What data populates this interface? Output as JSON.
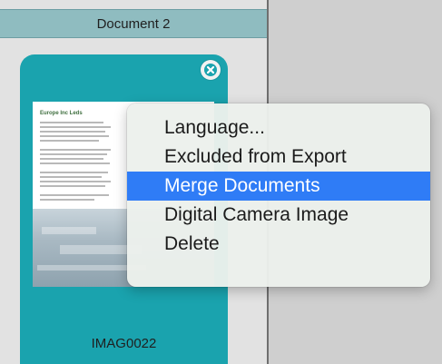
{
  "document_header": {
    "title": "Document 2"
  },
  "card": {
    "label": "IMAG0022",
    "thumbnail_title": "Europe Inc Leds",
    "close_icon": "close-circle-icon"
  },
  "context_menu": {
    "items": [
      {
        "label": "Language..."
      },
      {
        "label": "Excluded from Export"
      },
      {
        "label": "Merge Documents",
        "highlighted": true
      },
      {
        "label": "Digital Camera Image"
      },
      {
        "label": "Delete"
      }
    ],
    "highlight_color": "#2f7cf6"
  },
  "colors": {
    "card_teal": "#1aa3ae",
    "header_teal": "#8fbcc0"
  }
}
